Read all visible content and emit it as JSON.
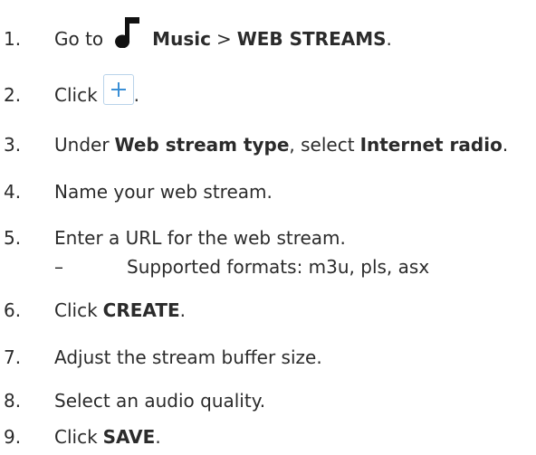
{
  "steps": [
    {
      "num": "1.",
      "before": "Go to",
      "icon": "music-note-icon",
      "link": "Music",
      "sep": ">",
      "target": "WEB STREAMS",
      "after": "."
    },
    {
      "num": "2.",
      "before": "Click",
      "icon": "plus-icon",
      "after": "."
    },
    {
      "num": "3.",
      "before": "Under",
      "bold1": "Web stream type",
      "mid": ", select",
      "bold2": "Internet radio",
      "after": "."
    },
    {
      "num": "4.",
      "text": "Name your web stream."
    },
    {
      "num": "5.",
      "text": "Enter a URL for the web stream."
    },
    {
      "num": "6.",
      "before": "Click",
      "bold1": "CREATE",
      "after": "."
    },
    {
      "num": "7.",
      "text": "Adjust the stream buffer size."
    },
    {
      "num": "8.",
      "text": "Select an audio quality."
    },
    {
      "num": "9.",
      "before": "Click",
      "bold1": "SAVE",
      "after": "."
    }
  ],
  "sub_bullet": {
    "dash": "–",
    "text": "Supported formats: m3u, pls, asx"
  },
  "colors": {
    "text": "#2b2b2b",
    "plus_blue": "#3a8fd6",
    "plus_border": "#b9d3ea"
  }
}
